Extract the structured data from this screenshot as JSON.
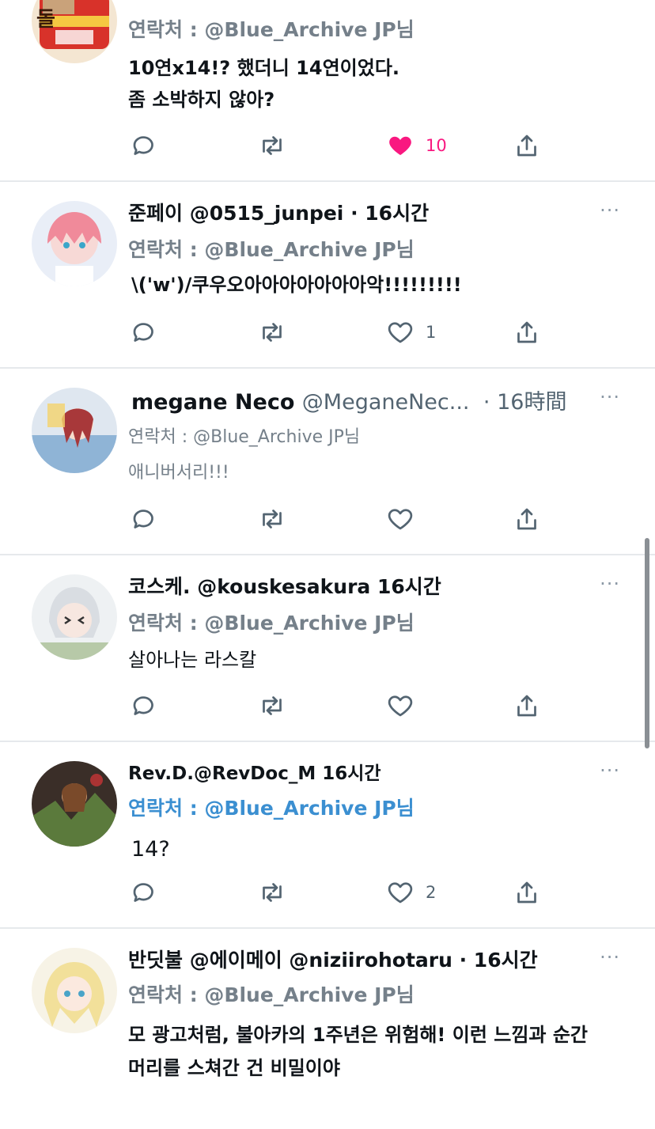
{
  "colors": {
    "like_active": "#f91880",
    "link_blue": "#3b8fd1",
    "muted": "#75808a",
    "divider": "#e6e9ec"
  },
  "tweets": [
    {
      "avatar_icon": "cup-noodle-avatar",
      "badge": "돌",
      "name": "",
      "handle": "",
      "time": "",
      "reply_to": "연락처 : @Blue_Archive JP님",
      "lines": [
        "10연x14!? 했더니 14연이었다.",
        "좀 소박하지 않아?"
      ],
      "likes": "10",
      "liked": true
    },
    {
      "avatar_icon": "anime-girl-avatar",
      "name": "준페이 @0515_junpei · 16시간",
      "reply_to": "연락처 : @Blue_Archive JP님",
      "lines": [
        "\\('w')/쿠우오아아아아아아아악!!!!!!!!!"
      ],
      "likes": "1"
    },
    {
      "avatar_icon": "anime-character-avatar",
      "name": "megane Neco",
      "handle": "@MeganeNec...",
      "time": "· 16時間",
      "reply_to": "연락처 : @Blue_Archive JP님",
      "lines": [
        "애니버서리!!!"
      ],
      "likes": ""
    },
    {
      "avatar_icon": "chibi-avatar",
      "name": "코스케. @kouskesakura 16시간",
      "reply_to": "연락처 : @Blue_Archive JP님",
      "lines": [
        "살아나는 라스칼"
      ],
      "likes": ""
    },
    {
      "avatar_icon": "dark-art-avatar",
      "name": "Rev.D.@RevDoc_M 16시간",
      "reply_to": "연락처 : @Blue_Archive JP님",
      "lines": [
        "14?"
      ],
      "likes": "2"
    },
    {
      "avatar_icon": "blonde-girl-avatar",
      "name": "반딧불 @에이메이 @niziirohotaru · 16시간",
      "reply_to": "연락처 : @Blue_Archive JP님",
      "lines": [
        "모 광고처럼, 불아카의 1주년은 위험해! 이런 느낌과 순간",
        "머리를 스쳐간 건 비밀이야"
      ],
      "likes": ""
    }
  ],
  "more_label": "···"
}
